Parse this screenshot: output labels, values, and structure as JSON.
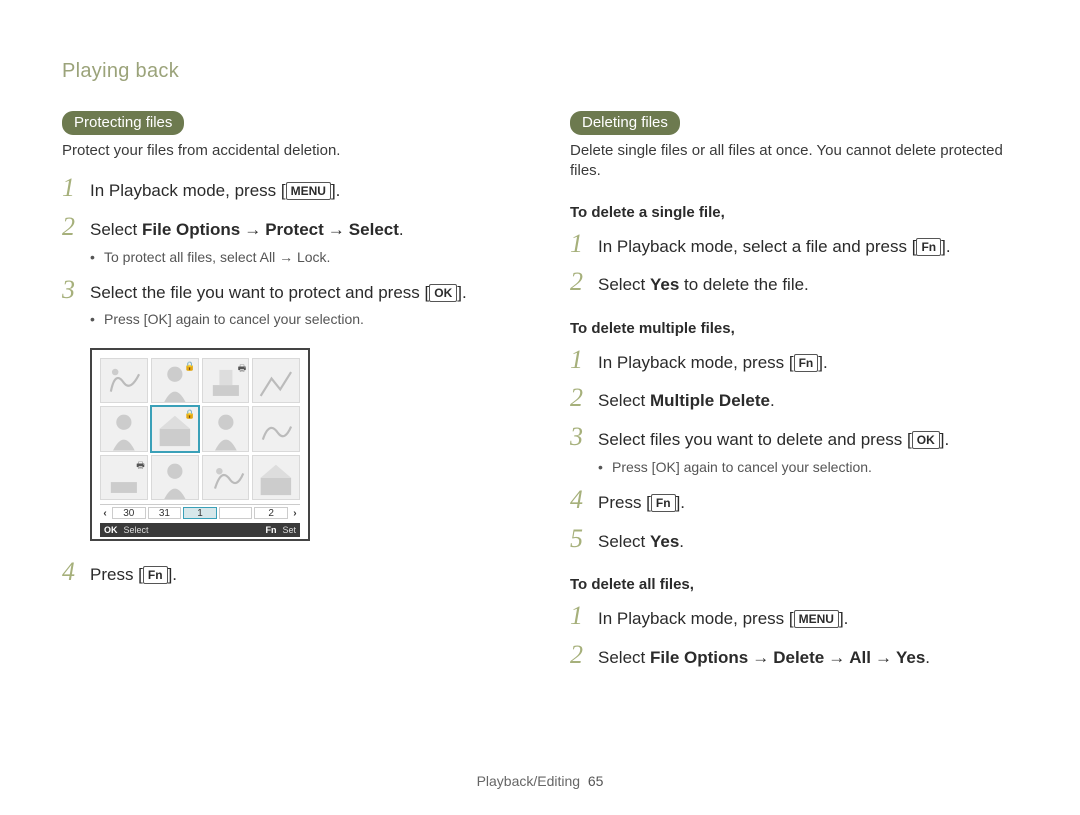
{
  "header": "Playing back",
  "left": {
    "pill": "Protecting files",
    "intro": "Protect your files from accidental deletion.",
    "steps": {
      "s1_a": "In Playback mode, press [",
      "s1_btn": "MENU",
      "s1_b": "].",
      "s2_a": "Select ",
      "s2_b": "File Options",
      "s2_arrow1": "→",
      "s2_c": "Protect",
      "s2_arrow2": "→",
      "s2_d": "Select",
      "s2_e": ".",
      "s2_sub": "To protect all files, select All → Lock.",
      "s3_a": "Select the file you want to protect and press [",
      "s3_btn": "OK",
      "s3_b": "].",
      "s3_sub_a": "Press [",
      "s3_sub_btn": "OK",
      "s3_sub_b": "] again to cancel your selection.",
      "s4_a": "Press [",
      "s4_btn": "Fn",
      "s4_b": "]."
    },
    "film": {
      "a": "30",
      "b": "31",
      "c": "1",
      "d": "2"
    },
    "status": {
      "ok": "OK",
      "okLabel": "Select",
      "fn": "Fn",
      "fnLabel": "Set"
    }
  },
  "right": {
    "pill": "Deleting files",
    "intro": "Delete single files or all files at once. You cannot delete protected files.",
    "single": {
      "head": "To delete a single file,",
      "s1_a": "In Playback mode, select a file and press [",
      "s1_btn": "Fn",
      "s1_b": "].",
      "s2_a": "Select ",
      "s2_b": "Yes",
      "s2_c": " to delete the file."
    },
    "multi": {
      "head": "To delete multiple files,",
      "s1_a": "In Playback mode, press [",
      "s1_btn": "Fn",
      "s1_b": "].",
      "s2_a": "Select ",
      "s2_b": "Multiple Delete",
      "s2_c": ".",
      "s3_a": "Select files you want to delete and press [",
      "s3_btn": "OK",
      "s3_b": "].",
      "s3_sub_a": "Press [",
      "s3_sub_btn": "OK",
      "s3_sub_b": "] again to cancel your selection.",
      "s4_a": "Press [",
      "s4_btn": "Fn",
      "s4_b": "].",
      "s5_a": "Select ",
      "s5_b": "Yes",
      "s5_c": "."
    },
    "all": {
      "head": "To delete all files,",
      "s1_a": "In Playback mode, press [",
      "s1_btn": "MENU",
      "s1_b": "].",
      "s2_a": "Select ",
      "s2_b": "File Options",
      "s2_arrow1": "→",
      "s2_c": "Delete",
      "s2_arrow2": "→",
      "s2_d": "All",
      "s2_arrow3": "→",
      "s2_e": "Yes",
      "s2_f": "."
    }
  },
  "footer": {
    "section": "Playback/Editing",
    "page": "65"
  }
}
